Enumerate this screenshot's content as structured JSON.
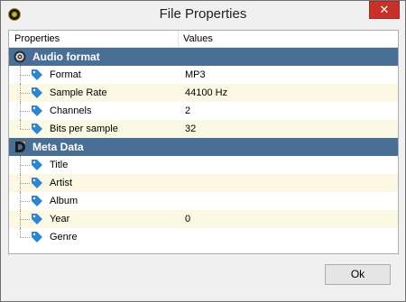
{
  "window": {
    "title": "File Properties",
    "close_glyph": "✕"
  },
  "columns": {
    "properties": "Properties",
    "values": "Values"
  },
  "groups": [
    {
      "label": "Audio format",
      "icon": "audio-disc-icon",
      "items": [
        {
          "label": "Format",
          "value": "MP3"
        },
        {
          "label": "Sample Rate",
          "value": "44100 Hz"
        },
        {
          "label": "Channels",
          "value": "2"
        },
        {
          "label": "Bits per sample",
          "value": "32"
        }
      ]
    },
    {
      "label": "Meta Data",
      "icon": "meta-data-icon",
      "items": [
        {
          "label": "Title",
          "value": ""
        },
        {
          "label": "Artist",
          "value": ""
        },
        {
          "label": "Album",
          "value": ""
        },
        {
          "label": "Year",
          "value": "0"
        },
        {
          "label": "Genre",
          "value": ""
        }
      ]
    }
  ],
  "buttons": {
    "ok": "Ok"
  },
  "colors": {
    "group_header_bg": "#4a6f96",
    "alt_row_bg": "#fbf9e4",
    "tag_icon": "#2f86d0",
    "close_button": "#c7312a"
  }
}
